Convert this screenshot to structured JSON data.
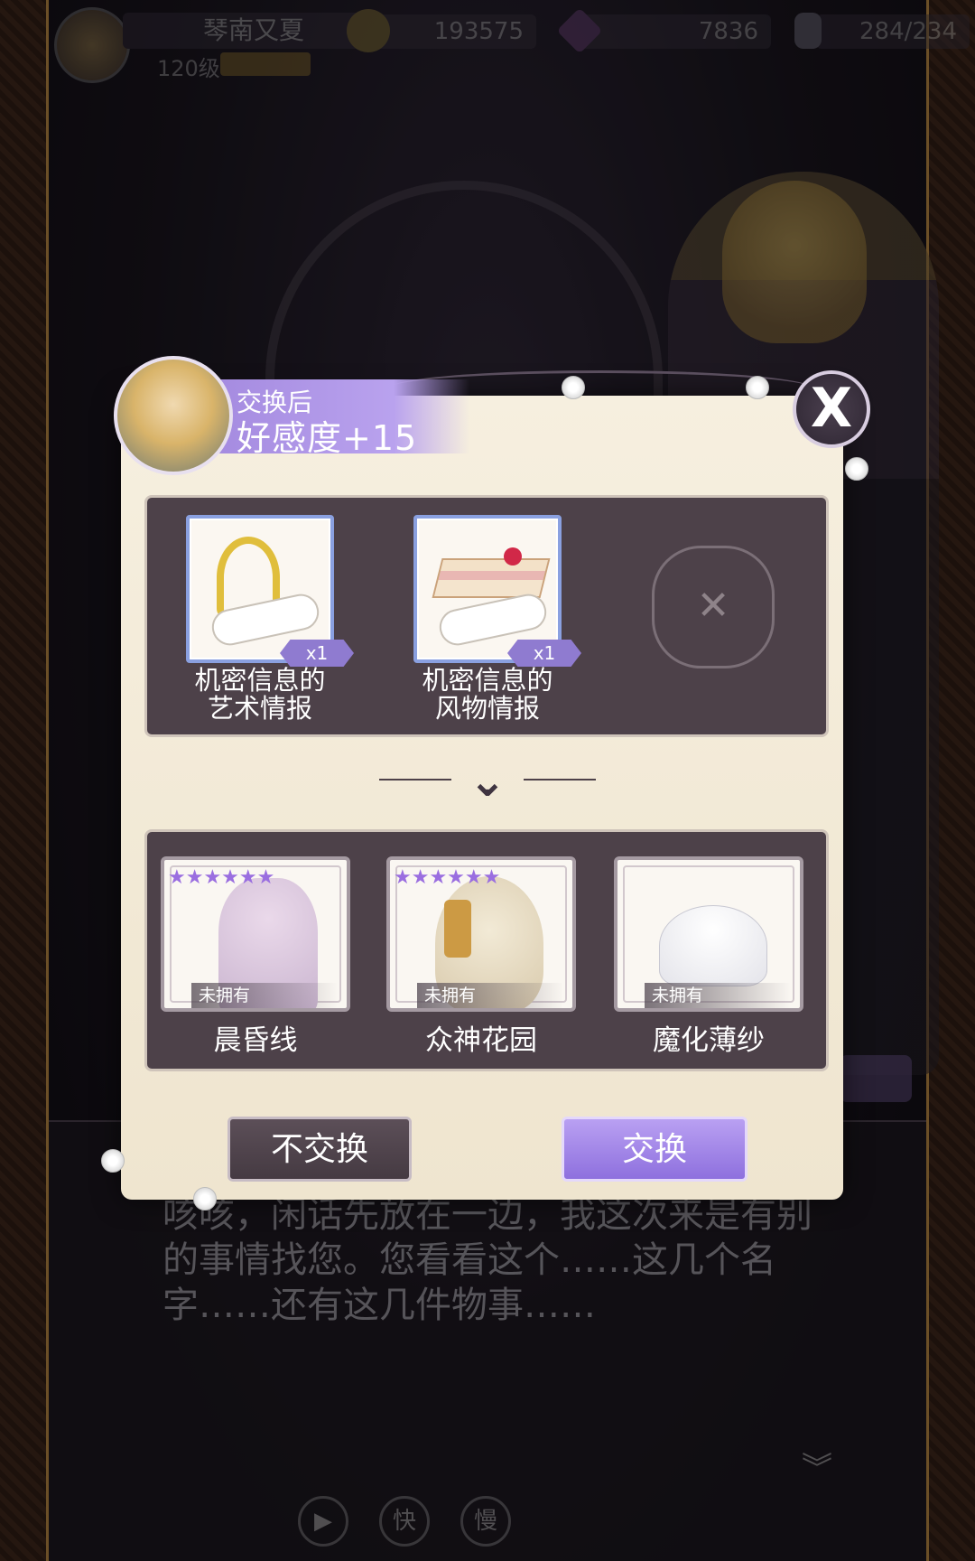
{
  "topbar": {
    "player_name": "琴南又夏",
    "level": "120级",
    "badge": "",
    "gold": "193575",
    "gems": "7836",
    "stamina": "284/234"
  },
  "dialog": {
    "text": "咳咳，闲话先放在一边，我这次来是有别的事情找您。您看看这个……这几个名字……还有这几件物事……"
  },
  "controls": {
    "play_icon": "play-icon",
    "fast_label": "快",
    "slow_label": "慢"
  },
  "modal": {
    "header_sub": "交换后",
    "header_main": "好感度+15",
    "close_label": "X",
    "cost_items": [
      {
        "name_line1": "机密信息的",
        "name_line2": "艺术情报",
        "qty": "x1",
        "icon": "harp-scroll-icon"
      },
      {
        "name_line1": "机密信息的",
        "name_line2": "风物情报",
        "qty": "x1",
        "icon": "cake-scroll-icon"
      }
    ],
    "empty_slot_icon": "crossed-swords-icon",
    "rewards": [
      {
        "name": "晨昏线",
        "status": "未拥有",
        "stars": "★★★★★★"
      },
      {
        "name": "众神花园",
        "status": "未拥有",
        "stars": "★★★★★★"
      },
      {
        "name": "魔化薄纱",
        "status": "未拥有",
        "stars": ""
      }
    ],
    "decline_label": "不交换",
    "confirm_label": "交换"
  },
  "colors": {
    "accent_purple": "#a58be0",
    "panel_bg": "#4d4149",
    "parchment": "#f6efdf"
  }
}
